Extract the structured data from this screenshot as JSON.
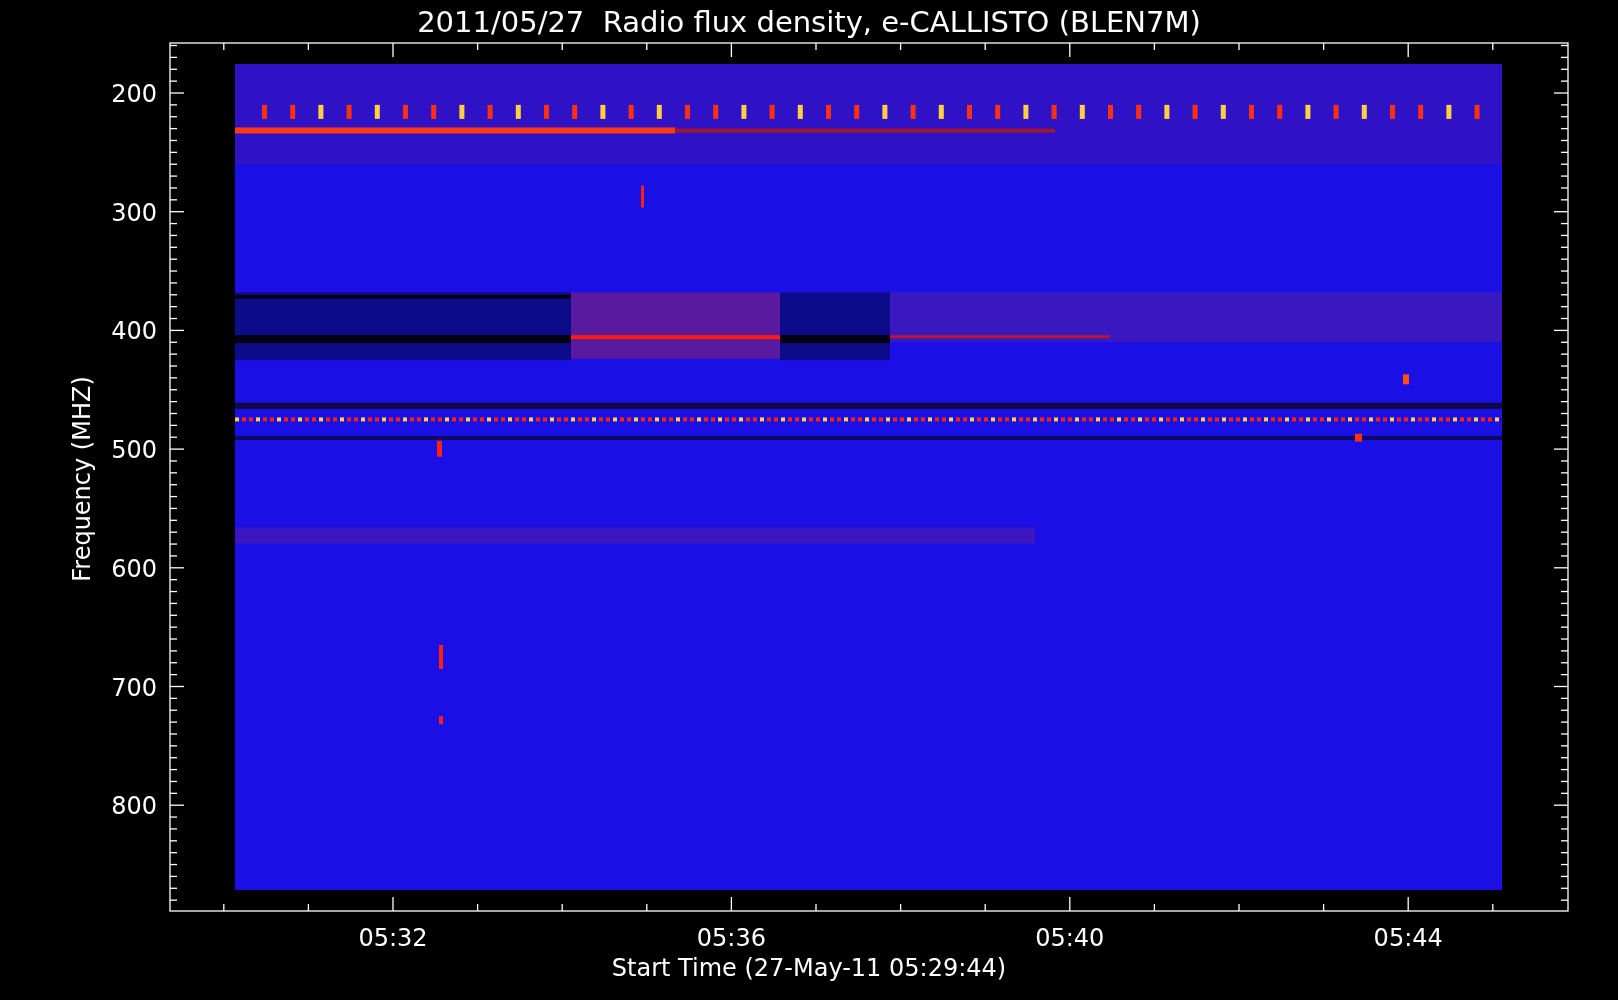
{
  "title": "2011/05/27  Radio flux density, e-CALLISTO (BLEN7M)",
  "y_axis": {
    "label": "Frequency (MHZ)",
    "ticks": [
      "200",
      "300",
      "400",
      "500",
      "600",
      "700",
      "800"
    ]
  },
  "x_axis": {
    "label": "Start Time (27-May-11 05:29:44)",
    "ticks": [
      "05:32",
      "05:36",
      "05:40",
      "05:44"
    ]
  }
}
